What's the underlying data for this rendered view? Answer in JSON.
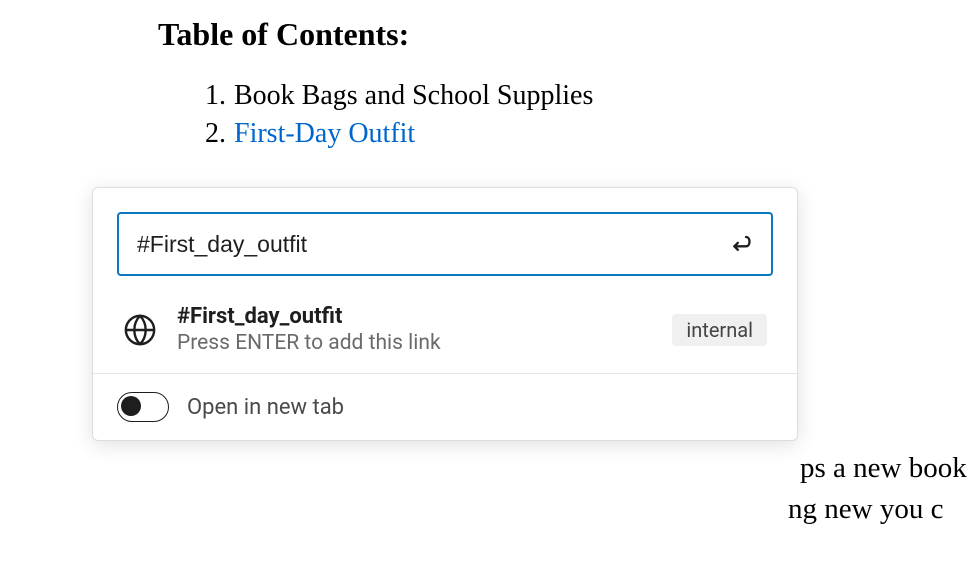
{
  "document": {
    "toc_heading": "Table of Contents:",
    "items": [
      {
        "number": "1.",
        "label": "Book Bags and School Supplies",
        "is_link": false
      },
      {
        "number": "2.",
        "label": "First-Day Outfit",
        "is_link": true
      }
    ],
    "body_fragment_line1": "ps a new book",
    "body_fragment_line2": "ng new you c"
  },
  "popover": {
    "input_value": "#First_day_outfit",
    "suggestion": {
      "title": "#First_day_outfit",
      "hint": "Press ENTER to add this link",
      "badge": "internal"
    },
    "footer": {
      "toggle_label": "Open in new tab",
      "toggle_on": false
    }
  }
}
